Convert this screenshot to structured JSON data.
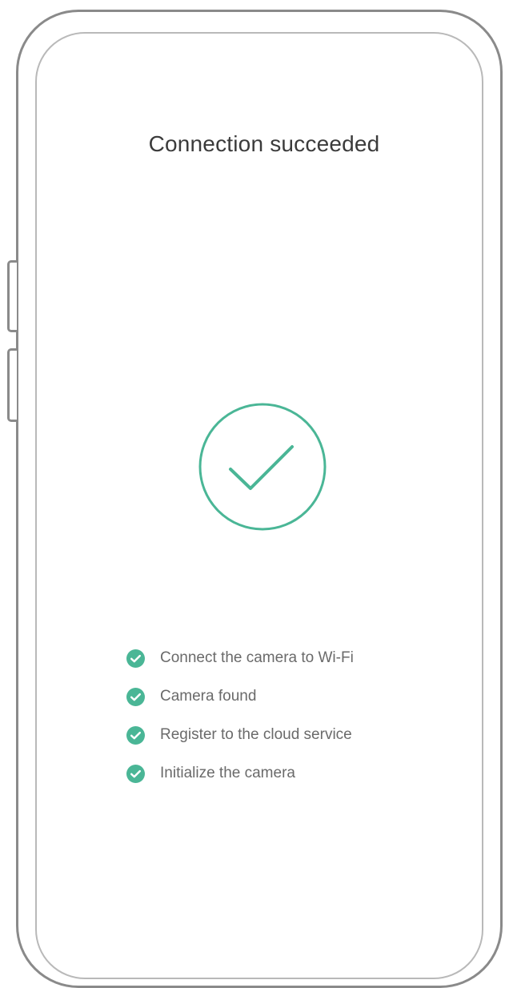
{
  "screen": {
    "title": "Connection succeeded"
  },
  "status_icon": {
    "name": "success-check-icon",
    "color": "#4ab696"
  },
  "steps": [
    {
      "label": "Connect the camera to Wi-Fi",
      "icon": "check-circle-icon",
      "status": "done"
    },
    {
      "label": "Camera found",
      "icon": "check-circle-icon",
      "status": "done"
    },
    {
      "label": "Register to the cloud service",
      "icon": "check-circle-icon",
      "status": "done"
    },
    {
      "label": "Initialize the camera",
      "icon": "check-circle-icon",
      "status": "done"
    }
  ],
  "colors": {
    "accent": "#4ab696",
    "frame": "#8a8a8a",
    "text": "#3b3b3b"
  }
}
